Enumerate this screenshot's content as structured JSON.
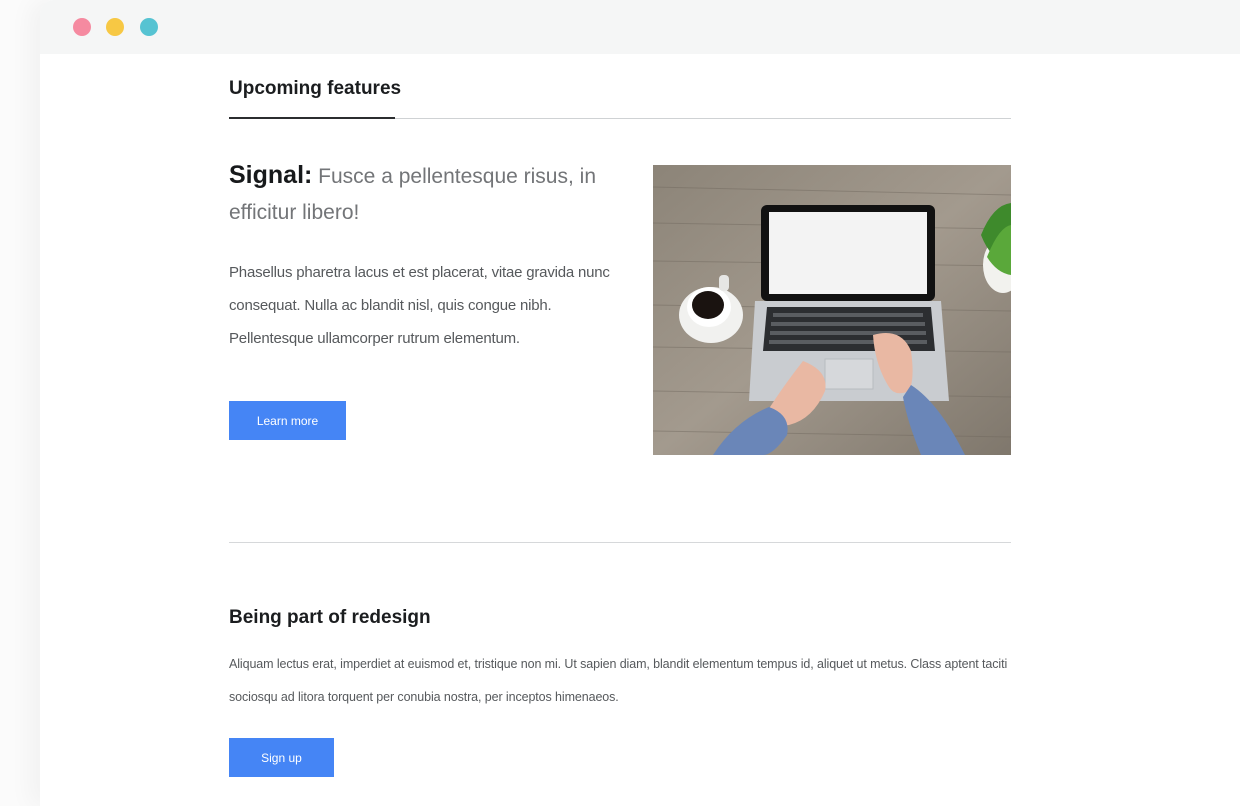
{
  "window": {
    "controls": [
      {
        "name": "close",
        "color": "#f58aa0"
      },
      {
        "name": "minimize",
        "color": "#f7c844"
      },
      {
        "name": "maximize",
        "color": "#56c3d2"
      }
    ]
  },
  "tabs": {
    "active_label": "Upcoming features"
  },
  "feature": {
    "title_strong": "Signal:",
    "title_rest": " Fusce a pellentesque risus, in efficitur libero!",
    "description": "Phasellus pharetra lacus et est placerat, vitae gravida nunc consequat. Nulla ac blandit nisl, quis congue nibh. Pellentesque ullamcorper rutrum elementum.",
    "button_label": "Learn more",
    "image_icon": "laptop-on-desk-photo"
  },
  "redesign": {
    "title": "Being part of redesign",
    "description": "Aliquam lectus erat, imperdiet at euismod et, tristique non mi. Ut sapien diam, blandit elementum tempus id, aliquet ut metus. Class aptent taciti sociosqu ad litora torquent per conubia nostra, per inceptos himenaeos.",
    "button_label": "Sign up"
  },
  "colors": {
    "accent": "#4585f5",
    "heading": "#1b1d1f",
    "body_text": "#56595c",
    "divider": "#d6d8da"
  }
}
